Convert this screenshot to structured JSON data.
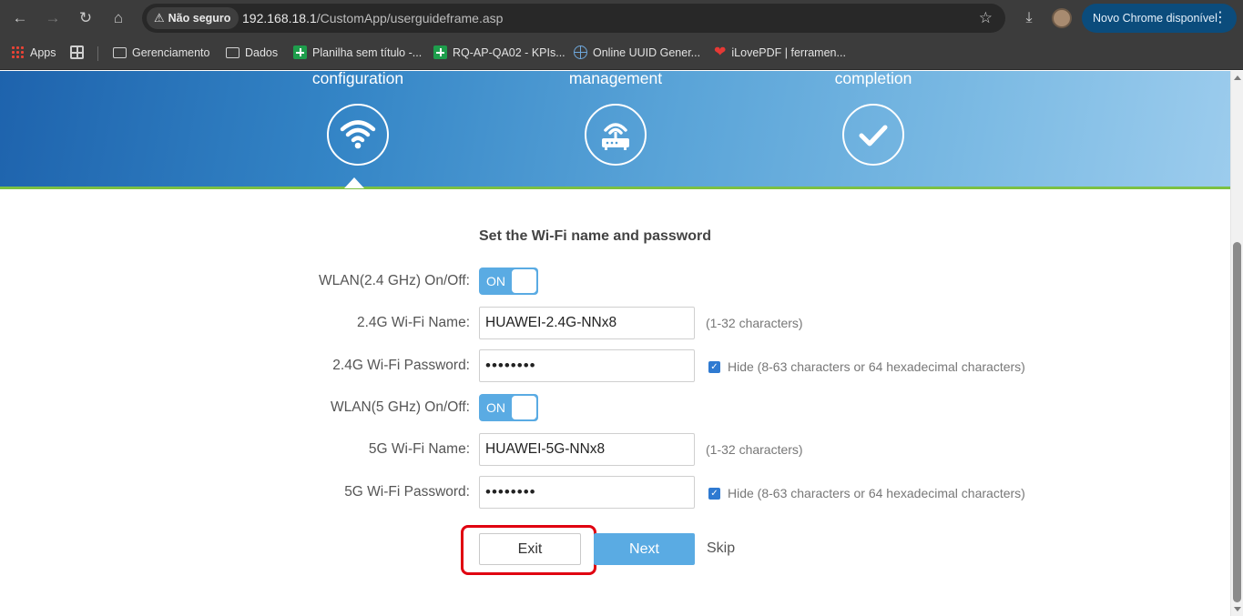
{
  "browser": {
    "security_chip": "Não seguro",
    "url_host": "192.168.18.1",
    "url_path": "/CustomApp/userguideframe.asp",
    "update_label": "Novo Chrome disponível",
    "nav_icons": [
      "back-arrow-icon",
      "forward-arrow-icon",
      "reload-icon",
      "home-icon"
    ],
    "bookmarks": [
      {
        "label": "Apps",
        "icon": "apps-grid-icon"
      },
      {
        "label": "",
        "icon": "tab-groups-icon"
      },
      {
        "label": "Gerenciamento",
        "icon": "folder-icon"
      },
      {
        "label": "Dados",
        "icon": "folder-icon"
      },
      {
        "label": "Planilha sem título -...",
        "icon": "sheets-icon"
      },
      {
        "label": "RQ-AP-QA02 - KPIs...",
        "icon": "sheets-icon"
      },
      {
        "label": "Online UUID Gener...",
        "icon": "globe-icon"
      },
      {
        "label": "iLovePDF | ferramen...",
        "icon": "heart-icon"
      }
    ]
  },
  "steps": [
    {
      "label": "configuration",
      "icon": "wifi-icon"
    },
    {
      "label": "management",
      "icon": "router-icon"
    },
    {
      "label": "completion",
      "icon": "checkmark-icon"
    }
  ],
  "form": {
    "title": "Set the Wi-Fi name and password",
    "wlan24_toggle_label": "WLAN(2.4 GHz) On/Off:",
    "wlan24_toggle_state": "ON",
    "wifi24_name_label": "2.4G Wi-Fi Name:",
    "wifi24_name_value": "HUAWEI-2.4G-NNx8",
    "wifi24_name_hint": "(1-32 characters)",
    "wifi24_password_label": "2.4G Wi-Fi Password:",
    "wifi24_password_value": "••••••••",
    "wifi24_hide_label": "Hide (8-63 characters or 64 hexadecimal characters)",
    "wlan5_toggle_label": "WLAN(5 GHz) On/Off:",
    "wlan5_toggle_state": "ON",
    "wifi5_name_label": "5G Wi-Fi Name:",
    "wifi5_name_value": "HUAWEI-5G-NNx8",
    "wifi5_name_hint": "(1-32 characters)",
    "wifi5_password_label": "5G Wi-Fi Password:",
    "wifi5_password_value": "••••••••",
    "wifi5_hide_label": "Hide (8-63 characters or 64 hexadecimal characters)"
  },
  "actions": {
    "exit_label": "Exit",
    "next_label": "Next",
    "skip_label": "Skip"
  },
  "colors": {
    "banner_blue": "#3485c6",
    "accent_green": "#7cc142",
    "button_blue": "#5aabe3",
    "highlight_red": "#e00010"
  }
}
